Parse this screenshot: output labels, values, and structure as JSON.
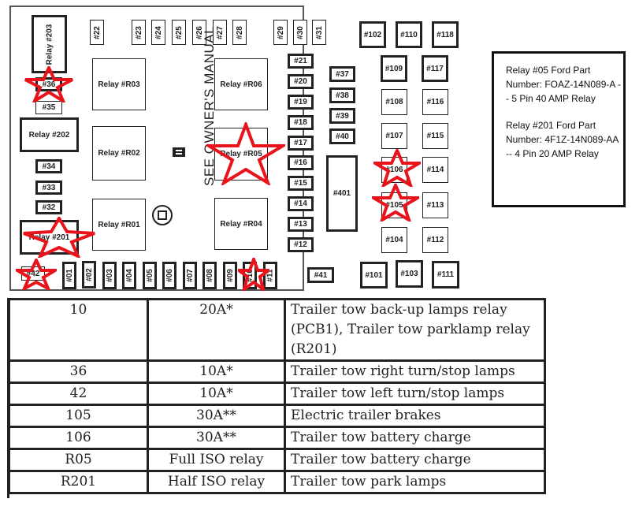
{
  "diagram": {
    "side_text": "SEE OWNER'S MANUAL",
    "highlight_color": "#e8131b",
    "top_fuses": [
      "#22",
      "#23",
      "#24",
      "#25",
      "#26",
      "#27",
      "#28",
      "#29",
      "#30",
      "#31"
    ],
    "top_right_fuses": [
      "#102",
      "#110",
      "#118"
    ],
    "relays": {
      "r203": "Relay  #203",
      "r202": "Relay  #202",
      "r201": "Relay  #201",
      "r03": "Relay  #R03",
      "r02": "Relay  #R02",
      "r01": "Relay  #R01",
      "r06": "Relay  #R06",
      "r05": "Relay  #R05",
      "r04": "Relay  #R04"
    },
    "left_fuses": [
      "#36",
      "#35",
      "#34",
      "#33",
      "#32"
    ],
    "center_column_fuses": [
      "#21",
      "#20",
      "#19",
      "#18",
      "#17",
      "#16",
      "#15",
      "#14",
      "#13",
      "#12"
    ],
    "mid_fuses": [
      "#37",
      "#38",
      "#39",
      "#40"
    ],
    "big_fuse": "#401",
    "right_col_a": [
      "#109",
      "#108",
      "#107",
      "#106",
      "#105",
      "#104"
    ],
    "right_col_b": [
      "#117",
      "#116",
      "#115",
      "#114",
      "#113",
      "#112"
    ],
    "bottom_fuses": [
      "#42",
      "#01",
      "#02",
      "#03",
      "#04",
      "#05",
      "#06",
      "#07",
      "#08",
      "#09",
      "#10",
      "#11"
    ],
    "bottom_misc": [
      "#41",
      "#101",
      "#103",
      "#111"
    ],
    "starred": [
      "#36",
      "#201",
      "#42",
      "#R05",
      "#10",
      "#106",
      "#105"
    ]
  },
  "note": {
    "paragraphs": [
      "Relay #05 Ford Part Number: FOAZ-14N089-A -- 5 Pin 40 AMP Relay",
      "Relay #201 Ford Part Number: 4F1Z-14N089-AA -- 4 Pin 20 AMP Relay"
    ]
  },
  "table": {
    "rows": [
      {
        "position": "10",
        "rating": "20A*",
        "description": "Trailer tow back-up lamps relay (PCB1), Trailer tow parklamp relay (R201)"
      },
      {
        "position": "36",
        "rating": "10A*",
        "description": "Trailer tow right turn/stop lamps"
      },
      {
        "position": "42",
        "rating": "10A*",
        "description": "Trailer tow left turn/stop lamps"
      },
      {
        "position": "105",
        "rating": "30A**",
        "description": "Electric trailer brakes"
      },
      {
        "position": "106",
        "rating": "30A**",
        "description": "Trailer tow battery charge"
      },
      {
        "position": "R05",
        "rating": "Full ISO relay",
        "description": "Trailer tow battery charge"
      },
      {
        "position": "R201",
        "rating": "Half ISO relay",
        "description": "Trailer tow park lamps"
      }
    ]
  }
}
